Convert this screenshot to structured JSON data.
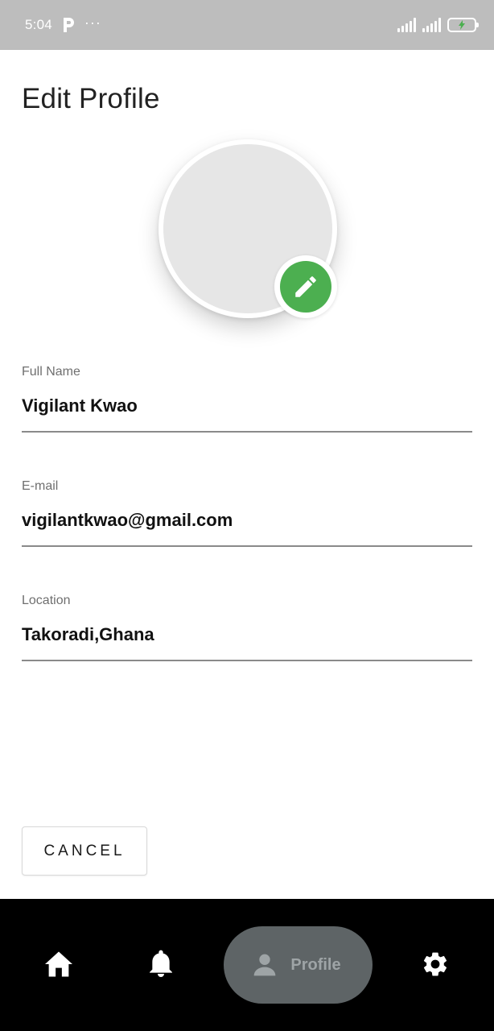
{
  "status_bar": {
    "time": "5:04",
    "app_icon": "p-icon",
    "more": "···",
    "icons": [
      "signal-icon",
      "signal-icon",
      "battery-charging-icon"
    ]
  },
  "page": {
    "title": "Edit Profile"
  },
  "avatar": {
    "edit_icon": "pencil-icon",
    "accent_color": "#4caf50"
  },
  "form": {
    "full_name": {
      "label": "Full Name",
      "value": "Vigilant Kwao"
    },
    "email": {
      "label": "E-mail",
      "value": "vigilantkwao@gmail.com"
    },
    "location": {
      "label": "Location",
      "value": "Takoradi,Ghana"
    }
  },
  "actions": {
    "cancel_label": "CANCEL"
  },
  "bottom_nav": {
    "items": [
      {
        "icon": "home-icon",
        "label": ""
      },
      {
        "icon": "bell-icon",
        "label": ""
      },
      {
        "icon": "person-icon",
        "label": "Profile",
        "active": true
      },
      {
        "icon": "gear-icon",
        "label": ""
      }
    ]
  }
}
